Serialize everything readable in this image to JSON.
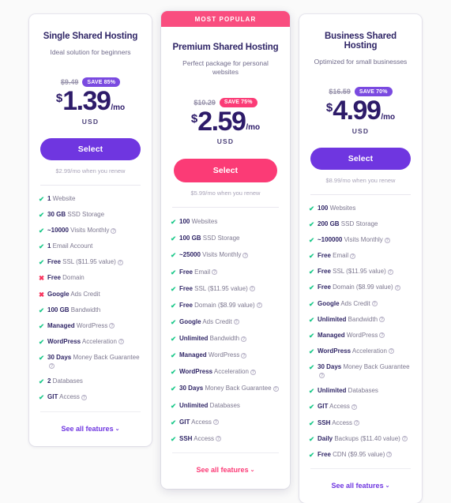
{
  "plans": [
    {
      "badge": null,
      "title": "Single Shared Hosting",
      "subtitle": "Ideal solution for beginners",
      "old_price": "$9.49",
      "save_label": "SAVE 85%",
      "currency_symbol": "$",
      "amount": "1.39",
      "per": "/mo",
      "currency_code": "USD",
      "cta_label": "Select",
      "renew_note": "$2.99/mo when you renew",
      "see_all_label": "See all features",
      "accent": "#6f36e0",
      "features": [
        {
          "mark": "yes",
          "strong": "1",
          "rest": " Website",
          "info": false
        },
        {
          "mark": "yes",
          "strong": "30 GB",
          "rest": " SSD Storage",
          "info": false
        },
        {
          "mark": "yes",
          "strong": "~10000",
          "rest": " Visits Monthly",
          "info": true
        },
        {
          "mark": "yes",
          "strong": "1",
          "rest": " Email Account",
          "info": false
        },
        {
          "mark": "yes",
          "strong": "Free",
          "rest": " SSL ($11.95 value)",
          "info": true
        },
        {
          "mark": "no",
          "strong": "Free",
          "rest": " Domain",
          "info": false
        },
        {
          "mark": "no",
          "strong": "Google",
          "rest": " Ads Credit",
          "info": false
        },
        {
          "mark": "yes",
          "strong": "100 GB",
          "rest": " Bandwidth",
          "info": false
        },
        {
          "mark": "yes",
          "strong": "Managed",
          "rest": " WordPress",
          "info": true
        },
        {
          "mark": "yes",
          "strong": "WordPress",
          "rest": " Acceleration",
          "info": true
        },
        {
          "mark": "yes",
          "strong": "30 Days",
          "rest": " Money Back Guarantee",
          "info": true
        },
        {
          "mark": "yes",
          "strong": "2",
          "rest": " Databases",
          "info": false
        },
        {
          "mark": "yes",
          "strong": "GIT",
          "rest": " Access",
          "info": true
        }
      ]
    },
    {
      "badge": "MOST POPULAR",
      "title": "Premium Shared Hosting",
      "subtitle": "Perfect package for personal websites",
      "old_price": "$10.29",
      "save_label": "SAVE 75%",
      "currency_symbol": "$",
      "amount": "2.59",
      "per": "/mo",
      "currency_code": "USD",
      "cta_label": "Select",
      "renew_note": "$5.99/mo when you renew",
      "see_all_label": "See all features",
      "accent": "#fb3b76",
      "features": [
        {
          "mark": "yes",
          "strong": "100",
          "rest": " Websites",
          "info": false
        },
        {
          "mark": "yes",
          "strong": "100 GB",
          "rest": " SSD Storage",
          "info": false
        },
        {
          "mark": "yes",
          "strong": "~25000",
          "rest": " Visits Monthly",
          "info": true
        },
        {
          "mark": "yes",
          "strong": "Free",
          "rest": " Email",
          "info": true
        },
        {
          "mark": "yes",
          "strong": "Free",
          "rest": " SSL ($11.95 value)",
          "info": true
        },
        {
          "mark": "yes",
          "strong": "Free",
          "rest": " Domain ($8.99 value)",
          "info": true
        },
        {
          "mark": "yes",
          "strong": "Google",
          "rest": " Ads Credit",
          "info": true
        },
        {
          "mark": "yes",
          "strong": "Unlimited",
          "rest": " Bandwidth",
          "info": true
        },
        {
          "mark": "yes",
          "strong": "Managed",
          "rest": " WordPress",
          "info": true
        },
        {
          "mark": "yes",
          "strong": "WordPress",
          "rest": " Acceleration",
          "info": true
        },
        {
          "mark": "yes",
          "strong": "30 Days",
          "rest": " Money Back Guarantee",
          "info": true
        },
        {
          "mark": "yes",
          "strong": "Unlimited",
          "rest": " Databases",
          "info": false
        },
        {
          "mark": "yes",
          "strong": "GIT",
          "rest": " Access",
          "info": true
        },
        {
          "mark": "yes",
          "strong": "SSH",
          "rest": " Access",
          "info": true
        }
      ]
    },
    {
      "badge": null,
      "title": "Business Shared Hosting",
      "subtitle": "Optimized for small businesses",
      "old_price": "$16.59",
      "save_label": "SAVE 70%",
      "currency_symbol": "$",
      "amount": "4.99",
      "per": "/mo",
      "currency_code": "USD",
      "cta_label": "Select",
      "renew_note": "$8.99/mo when you renew",
      "see_all_label": "See all features",
      "accent": "#6f36e0",
      "features": [
        {
          "mark": "yes",
          "strong": "100",
          "rest": " Websites",
          "info": false
        },
        {
          "mark": "yes",
          "strong": "200 GB",
          "rest": " SSD Storage",
          "info": false
        },
        {
          "mark": "yes",
          "strong": "~100000",
          "rest": " Visits Monthly",
          "info": true
        },
        {
          "mark": "yes",
          "strong": "Free",
          "rest": " Email",
          "info": true
        },
        {
          "mark": "yes",
          "strong": "Free",
          "rest": " SSL ($11.95 value)",
          "info": true
        },
        {
          "mark": "yes",
          "strong": "Free",
          "rest": " Domain ($8.99 value)",
          "info": true
        },
        {
          "mark": "yes",
          "strong": "Google",
          "rest": " Ads Credit",
          "info": true
        },
        {
          "mark": "yes",
          "strong": "Unlimited",
          "rest": " Bandwidth",
          "info": true
        },
        {
          "mark": "yes",
          "strong": "Managed",
          "rest": " WordPress",
          "info": true
        },
        {
          "mark": "yes",
          "strong": "WordPress",
          "rest": " Acceleration",
          "info": true
        },
        {
          "mark": "yes",
          "strong": "30 Days",
          "rest": " Money Back Guarantee",
          "info": true
        },
        {
          "mark": "yes",
          "strong": "Unlimited",
          "rest": " Databases",
          "info": false
        },
        {
          "mark": "yes",
          "strong": "GIT",
          "rest": " Access",
          "info": true
        },
        {
          "mark": "yes",
          "strong": "SSH",
          "rest": " Access",
          "info": true
        },
        {
          "mark": "yes",
          "strong": "Daily",
          "rest": " Backups ($11.40 value)",
          "info": true
        },
        {
          "mark": "yes",
          "strong": "Free",
          "rest": " CDN ($9.95 value)",
          "info": true
        }
      ]
    }
  ],
  "icons": {
    "check": "✔",
    "cross": "✖",
    "info": "?",
    "chevron_down": "⌄"
  }
}
